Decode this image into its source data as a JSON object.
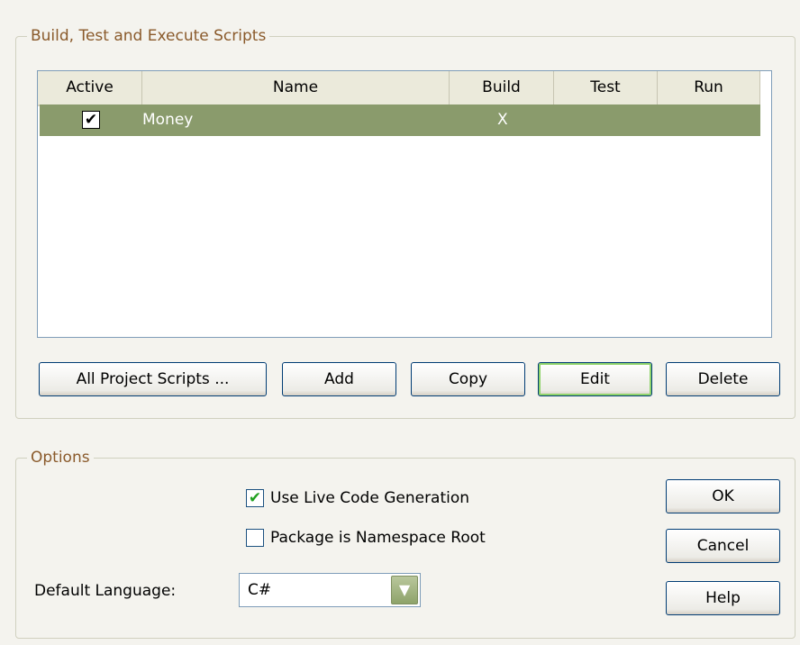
{
  "build_group": {
    "title": "Build, Test and Execute Scripts",
    "columns": [
      "Active",
      "Name",
      "Build",
      "Test",
      "Run"
    ],
    "rows": [
      {
        "active": "✔",
        "name": "Money",
        "build": "X",
        "test": "",
        "run": ""
      }
    ],
    "buttons": {
      "all_scripts": "All Project Scripts ...",
      "add": "Add",
      "copy": "Copy",
      "edit": "Edit",
      "delete": "Delete"
    }
  },
  "options_group": {
    "title": "Options",
    "live_code_label": "Use Live Code Generation",
    "live_code_checked": "✔",
    "namespace_label": "Package is Namespace Root",
    "namespace_checked": "",
    "default_language_label": "Default Language:",
    "default_language_value": "C#",
    "dropdown_icon": "chevron-down-icon"
  },
  "dialog_buttons": {
    "ok": "OK",
    "cancel": "Cancel",
    "help": "Help"
  },
  "colors": {
    "group_title": "#8a5a2b",
    "selected_row": "#8a9b6c",
    "button_border": "#003c74"
  }
}
